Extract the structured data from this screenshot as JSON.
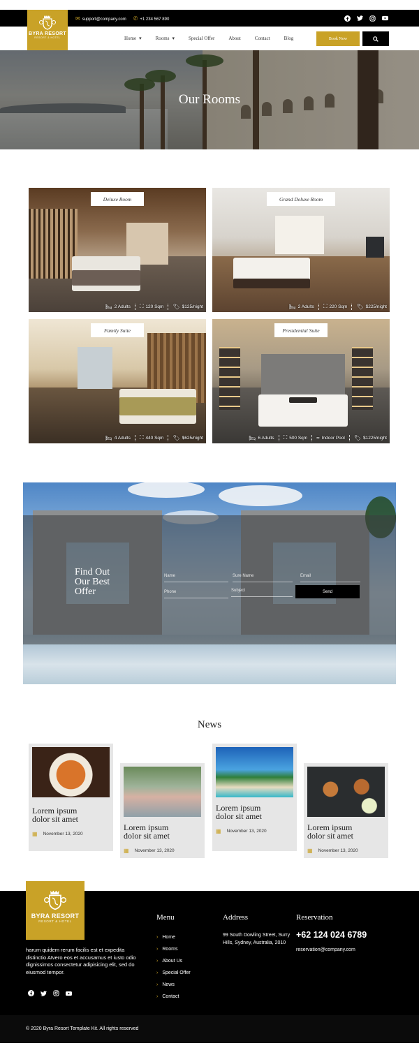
{
  "topbar": {
    "email": "support@company.com",
    "phone": "+1 234 567 890",
    "social": [
      "facebook-icon",
      "twitter-icon",
      "instagram-icon",
      "youtube-icon"
    ]
  },
  "brand": {
    "name": "BYRA RESORT",
    "tagline": "RESORT & HOTEL",
    "accent": "#c9a227"
  },
  "nav": {
    "items": [
      {
        "label": "Home",
        "dropdown": true
      },
      {
        "label": "Rooms",
        "dropdown": true
      },
      {
        "label": "Special Offer",
        "dropdown": false
      },
      {
        "label": "About",
        "dropdown": false
      },
      {
        "label": "Contact",
        "dropdown": false
      },
      {
        "label": "Blog",
        "dropdown": false
      }
    ],
    "book_now": "Book Now"
  },
  "hero": {
    "title": "Our Rooms"
  },
  "rooms": [
    {
      "name": "Deluxe Room",
      "guests": "2 Adults",
      "size": "120 Sqm",
      "price": "$125/night"
    },
    {
      "name": "Grand Deluxe Room",
      "guests": "2 Adults",
      "size": "220 Sqm",
      "price": "$225/night"
    },
    {
      "name": "Family Suite",
      "guests": "4 Adults",
      "size": "440 Sqm",
      "price": "$625/night"
    },
    {
      "name": "Presidential Suite",
      "guests": "6 Adults",
      "size": "500 Sqm",
      "extra": "Indoor Pool",
      "price": "$1225/night"
    }
  ],
  "offer": {
    "heading_line1": "Find Out",
    "heading_line2": "Our Best",
    "heading_line3": "Offer",
    "fields": {
      "name": "Name",
      "surname": "Sure Name",
      "email": "Email",
      "phone": "Phone",
      "subject": "Subject"
    },
    "send": "Send"
  },
  "news": {
    "title": "News",
    "items": [
      {
        "title_line1": "Lorem ipsum",
        "title_line2": "dolor sit amet",
        "date": "November 13, 2020"
      },
      {
        "title_line1": "Lorem ipsum",
        "title_line2": "dolor sit amet",
        "date": "November 13, 2020"
      },
      {
        "title_line1": "Lorem ipsum",
        "title_line2": "dolor sit amet",
        "date": "November 13, 2020"
      },
      {
        "title_line1": "Lorem ipsum",
        "title_line2": "dolor sit amet",
        "date": "November 13, 2020"
      }
    ]
  },
  "footer": {
    "description": "harum quidem rerum facilis est et expedita distinctio Atvero eos et accusamus et iusto odio dignissimos consectetur adipisicing elit, sed do eiusmod tempor.",
    "menu_title": "Menu",
    "menu": [
      "Home",
      "Rooms",
      "About Us",
      "Special Offer",
      "News",
      "Contact"
    ],
    "address_title": "Address",
    "address": "99 South Dowling Street, Surry Hills, Sydney, Australia, 2010",
    "reservation_title": "Reservation",
    "phone": "+62 124 024 6789",
    "email": "reservation@company.com",
    "copyright": "© 2020 Byra Resort Template Kit. All rights reserved"
  }
}
